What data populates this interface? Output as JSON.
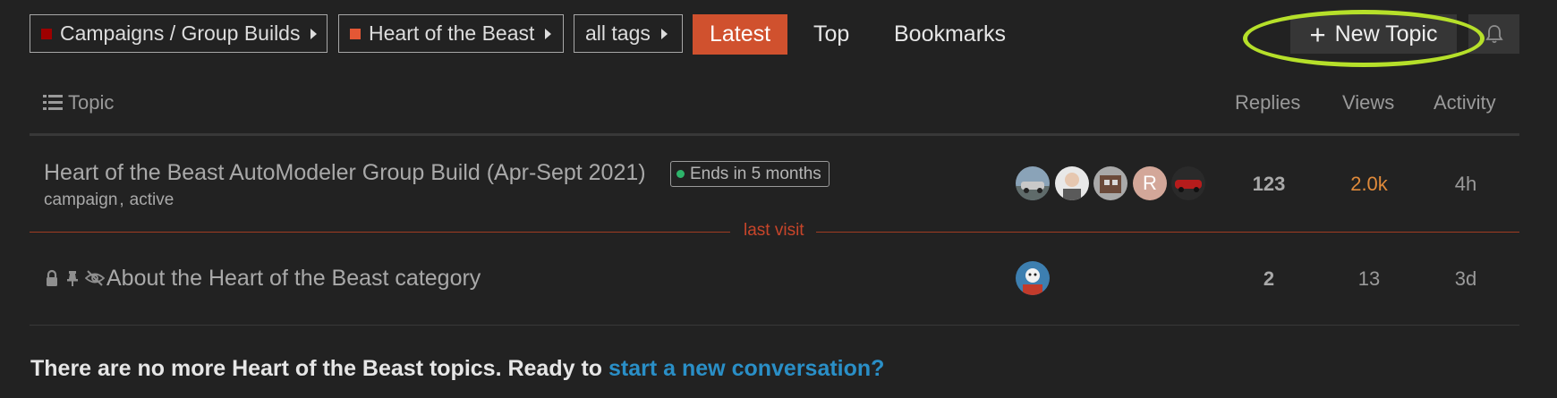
{
  "nav": {
    "category": {
      "label": "Campaigns / Group Builds",
      "color": "#9e0000"
    },
    "subcategory": {
      "label": "Heart of the Beast",
      "color": "#e45735"
    },
    "tags": {
      "label": "all tags"
    },
    "tabs": [
      {
        "label": "Latest",
        "active": true
      },
      {
        "label": "Top",
        "active": false
      },
      {
        "label": "Bookmarks",
        "active": false
      }
    ],
    "new_topic_label": "New Topic",
    "plus_glyph": "+",
    "icons": {
      "list": "list-icon",
      "bell": "bell-icon",
      "caret": "caret-right-icon",
      "lock": "lock-icon",
      "pin": "pin-icon",
      "unlisted": "eye-slash-icon"
    }
  },
  "table": {
    "headers": {
      "topic": "Topic",
      "replies": "Replies",
      "views": "Views",
      "activity": "Activity"
    },
    "topics": [
      {
        "title": "Heart of the Beast AutoModeler Group Build (Apr-Sept 2021)",
        "status_badge": "Ends in 5 months",
        "tags": [
          "campaign",
          "active"
        ],
        "tag_separator": ",",
        "replies": "123",
        "views": "2.0k",
        "activity": "4h",
        "posters": [
          "avatar-1",
          "avatar-2",
          "avatar-3",
          "R",
          "avatar-5"
        ],
        "colors": {
          "views": "#e08a3a",
          "replies": "#a9a9a9"
        }
      },
      {
        "title": "About the Heart of the Beast category",
        "replies": "2",
        "views": "13",
        "activity": "3d",
        "posters": [
          "avatar-1"
        ]
      }
    ],
    "last_visit_label": "last visit"
  },
  "footer": {
    "message": "There are no more Heart of the Beast topics. Ready to",
    "link": "start a new conversation?"
  },
  "colors": {
    "accent": "#d0512e",
    "highlight": "#b6e02a",
    "link": "#2a8fc7",
    "background": "#222222"
  }
}
